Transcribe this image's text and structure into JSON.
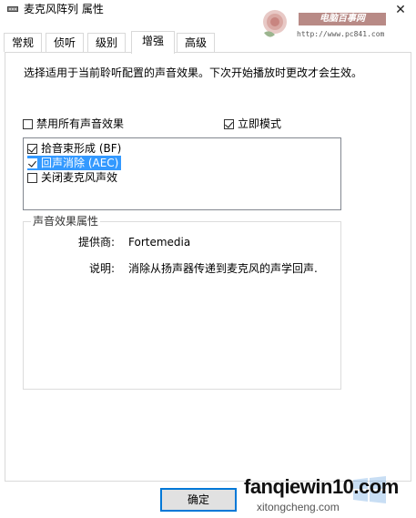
{
  "window": {
    "title": "麦克风阵列 属性",
    "close_symbol": "✕"
  },
  "tabs": [
    {
      "label": "常规"
    },
    {
      "label": "侦听"
    },
    {
      "label": "级别"
    },
    {
      "label": "增强",
      "active": true
    },
    {
      "label": "高级"
    }
  ],
  "enhancements": {
    "description": "选择适用于当前聆听配置的声音效果。下次开始播放时更改才会生效。",
    "disable_all": {
      "label": "禁用所有声音效果",
      "checked": false
    },
    "immediate_mode": {
      "label": "立即模式",
      "checked": true
    },
    "effects": [
      {
        "label": "拾音束形成 (BF)",
        "checked": true,
        "selected": false
      },
      {
        "label": "回声消除 (AEC)",
        "checked": true,
        "selected": true
      },
      {
        "label": "关闭麦克风声效",
        "checked": false,
        "selected": false
      }
    ],
    "properties": {
      "group_title": "声音效果属性",
      "provider_label": "提供商:",
      "provider_value": "Fortemedia",
      "description_label": "说明:",
      "description_value": "消除从扬声器传递到麦克风的声学回声."
    }
  },
  "buttons": {
    "ok_label": "确定"
  },
  "watermarks": {
    "top_title": "电脑百事网",
    "top_url": "http://www.pc841.com",
    "bottom_main": "fanqiewin10.com",
    "bottom_sub": "xitongcheng.com"
  },
  "colors": {
    "selection": "#3399ff",
    "default_button_border": "#0078d7",
    "watermark_banner": "#b88a86"
  }
}
